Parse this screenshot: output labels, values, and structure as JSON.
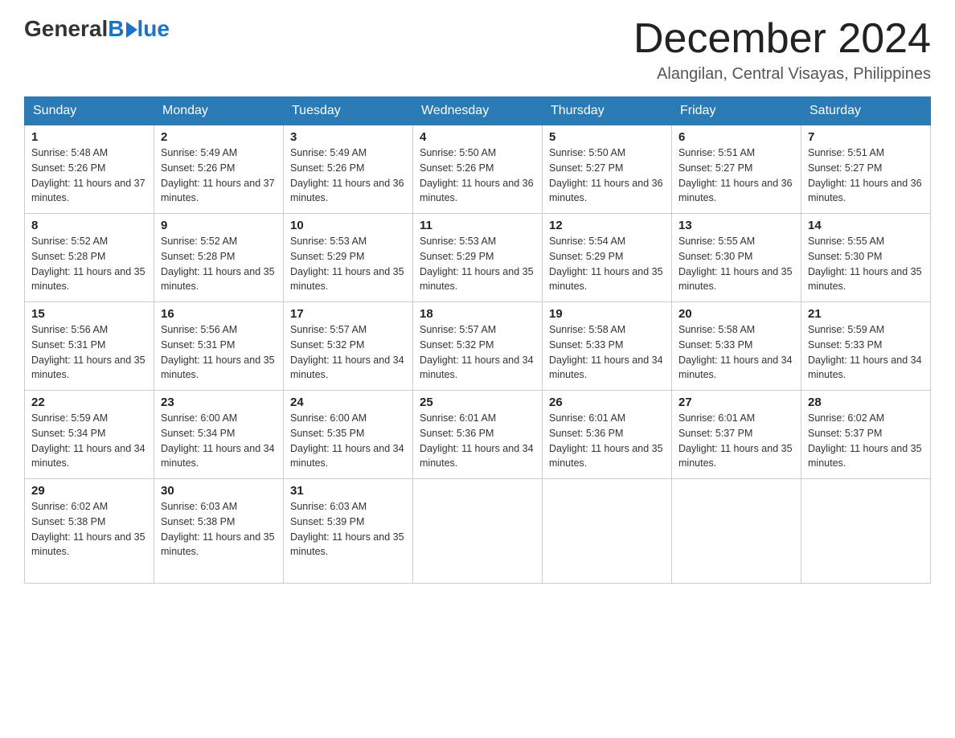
{
  "logo": {
    "general": "General",
    "blue": "Blue"
  },
  "title": "December 2024",
  "location": "Alangilan, Central Visayas, Philippines",
  "headers": [
    "Sunday",
    "Monday",
    "Tuesday",
    "Wednesday",
    "Thursday",
    "Friday",
    "Saturday"
  ],
  "weeks": [
    [
      {
        "day": "1",
        "sunrise": "5:48 AM",
        "sunset": "5:26 PM",
        "daylight": "11 hours and 37 minutes."
      },
      {
        "day": "2",
        "sunrise": "5:49 AM",
        "sunset": "5:26 PM",
        "daylight": "11 hours and 37 minutes."
      },
      {
        "day": "3",
        "sunrise": "5:49 AM",
        "sunset": "5:26 PM",
        "daylight": "11 hours and 36 minutes."
      },
      {
        "day": "4",
        "sunrise": "5:50 AM",
        "sunset": "5:26 PM",
        "daylight": "11 hours and 36 minutes."
      },
      {
        "day": "5",
        "sunrise": "5:50 AM",
        "sunset": "5:27 PM",
        "daylight": "11 hours and 36 minutes."
      },
      {
        "day": "6",
        "sunrise": "5:51 AM",
        "sunset": "5:27 PM",
        "daylight": "11 hours and 36 minutes."
      },
      {
        "day": "7",
        "sunrise": "5:51 AM",
        "sunset": "5:27 PM",
        "daylight": "11 hours and 36 minutes."
      }
    ],
    [
      {
        "day": "8",
        "sunrise": "5:52 AM",
        "sunset": "5:28 PM",
        "daylight": "11 hours and 35 minutes."
      },
      {
        "day": "9",
        "sunrise": "5:52 AM",
        "sunset": "5:28 PM",
        "daylight": "11 hours and 35 minutes."
      },
      {
        "day": "10",
        "sunrise": "5:53 AM",
        "sunset": "5:29 PM",
        "daylight": "11 hours and 35 minutes."
      },
      {
        "day": "11",
        "sunrise": "5:53 AM",
        "sunset": "5:29 PM",
        "daylight": "11 hours and 35 minutes."
      },
      {
        "day": "12",
        "sunrise": "5:54 AM",
        "sunset": "5:29 PM",
        "daylight": "11 hours and 35 minutes."
      },
      {
        "day": "13",
        "sunrise": "5:55 AM",
        "sunset": "5:30 PM",
        "daylight": "11 hours and 35 minutes."
      },
      {
        "day": "14",
        "sunrise": "5:55 AM",
        "sunset": "5:30 PM",
        "daylight": "11 hours and 35 minutes."
      }
    ],
    [
      {
        "day": "15",
        "sunrise": "5:56 AM",
        "sunset": "5:31 PM",
        "daylight": "11 hours and 35 minutes."
      },
      {
        "day": "16",
        "sunrise": "5:56 AM",
        "sunset": "5:31 PM",
        "daylight": "11 hours and 35 minutes."
      },
      {
        "day": "17",
        "sunrise": "5:57 AM",
        "sunset": "5:32 PM",
        "daylight": "11 hours and 34 minutes."
      },
      {
        "day": "18",
        "sunrise": "5:57 AM",
        "sunset": "5:32 PM",
        "daylight": "11 hours and 34 minutes."
      },
      {
        "day": "19",
        "sunrise": "5:58 AM",
        "sunset": "5:33 PM",
        "daylight": "11 hours and 34 minutes."
      },
      {
        "day": "20",
        "sunrise": "5:58 AM",
        "sunset": "5:33 PM",
        "daylight": "11 hours and 34 minutes."
      },
      {
        "day": "21",
        "sunrise": "5:59 AM",
        "sunset": "5:33 PM",
        "daylight": "11 hours and 34 minutes."
      }
    ],
    [
      {
        "day": "22",
        "sunrise": "5:59 AM",
        "sunset": "5:34 PM",
        "daylight": "11 hours and 34 minutes."
      },
      {
        "day": "23",
        "sunrise": "6:00 AM",
        "sunset": "5:34 PM",
        "daylight": "11 hours and 34 minutes."
      },
      {
        "day": "24",
        "sunrise": "6:00 AM",
        "sunset": "5:35 PM",
        "daylight": "11 hours and 34 minutes."
      },
      {
        "day": "25",
        "sunrise": "6:01 AM",
        "sunset": "5:36 PM",
        "daylight": "11 hours and 34 minutes."
      },
      {
        "day": "26",
        "sunrise": "6:01 AM",
        "sunset": "5:36 PM",
        "daylight": "11 hours and 35 minutes."
      },
      {
        "day": "27",
        "sunrise": "6:01 AM",
        "sunset": "5:37 PM",
        "daylight": "11 hours and 35 minutes."
      },
      {
        "day": "28",
        "sunrise": "6:02 AM",
        "sunset": "5:37 PM",
        "daylight": "11 hours and 35 minutes."
      }
    ],
    [
      {
        "day": "29",
        "sunrise": "6:02 AM",
        "sunset": "5:38 PM",
        "daylight": "11 hours and 35 minutes."
      },
      {
        "day": "30",
        "sunrise": "6:03 AM",
        "sunset": "5:38 PM",
        "daylight": "11 hours and 35 minutes."
      },
      {
        "day": "31",
        "sunrise": "6:03 AM",
        "sunset": "5:39 PM",
        "daylight": "11 hours and 35 minutes."
      },
      null,
      null,
      null,
      null
    ]
  ]
}
